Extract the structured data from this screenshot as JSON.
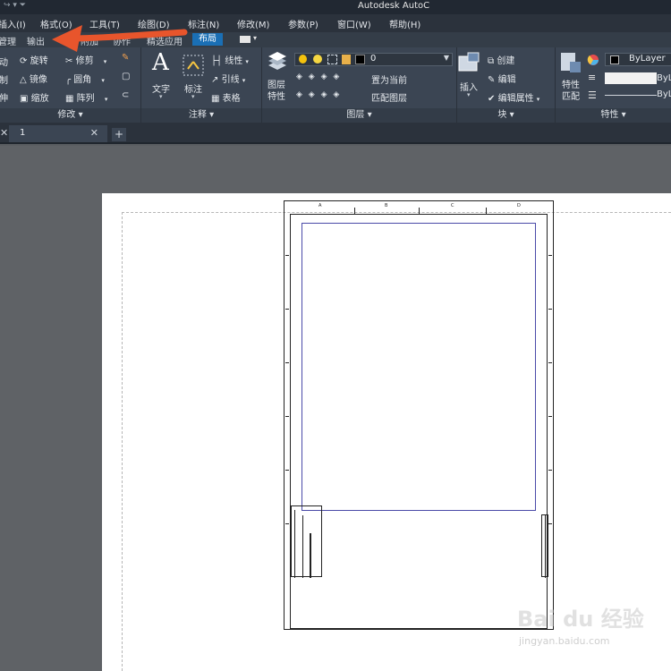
{
  "titlebar": {
    "title": "Autodesk AutoC",
    "quick_access": "↪ ▾ ⏷"
  },
  "menubar": {
    "items": [
      {
        "label": "插入(I)"
      },
      {
        "label": "格式(O)"
      },
      {
        "label": "工具(T)"
      },
      {
        "label": "绘图(D)"
      },
      {
        "label": "标注(N)"
      },
      {
        "label": "修改(M)"
      },
      {
        "label": "参数(P)"
      },
      {
        "label": "窗口(W)"
      },
      {
        "label": "帮助(H)"
      }
    ]
  },
  "ribbon_tabs": {
    "items": [
      {
        "label": "管理"
      },
      {
        "label": "输出"
      },
      {
        "label": "附加"
      },
      {
        "label": "协作"
      },
      {
        "label": "精选应用"
      },
      {
        "label": "布局"
      }
    ],
    "active": "布局"
  },
  "ribbon": {
    "modify": {
      "left_items": [
        "动",
        "制",
        "伸"
      ],
      "rotate": "旋转",
      "mirror": "镜像",
      "scale": "缩放",
      "trim": "修剪",
      "fillet": "圆角",
      "array": "阵列",
      "footer": "修改 ▾"
    },
    "annotation": {
      "text": "文字",
      "dimension": "标注",
      "linear": "线性",
      "leader": "引线",
      "table": "表格",
      "footer": "注释 ▾"
    },
    "layers": {
      "layer_props": "图层\n特性",
      "current_layer": "0",
      "make_current": "置为当前",
      "match_layer": "匹配图层",
      "footer": "图层 ▾"
    },
    "block": {
      "insert": "插入",
      "create": "创建",
      "edit": "编辑",
      "edit_attrs": "编辑属性",
      "footer": "块 ▾"
    },
    "properties": {
      "match": "特性\n匹配",
      "color": "ByLayer",
      "linetype": "ByL",
      "lineweight": "ByL",
      "footer": "特性 ▾"
    }
  },
  "doc_tabs": {
    "tab_name": "1"
  },
  "titleblock_labels": [
    "A",
    "B",
    "C",
    "D"
  ],
  "watermark": {
    "brand": "Bai du 经验",
    "site": "jingyan.baidu.com"
  },
  "colors": {
    "accent": "#1a6fb5",
    "arrow": "#e8552c",
    "viewport": "#4a4aa8"
  }
}
